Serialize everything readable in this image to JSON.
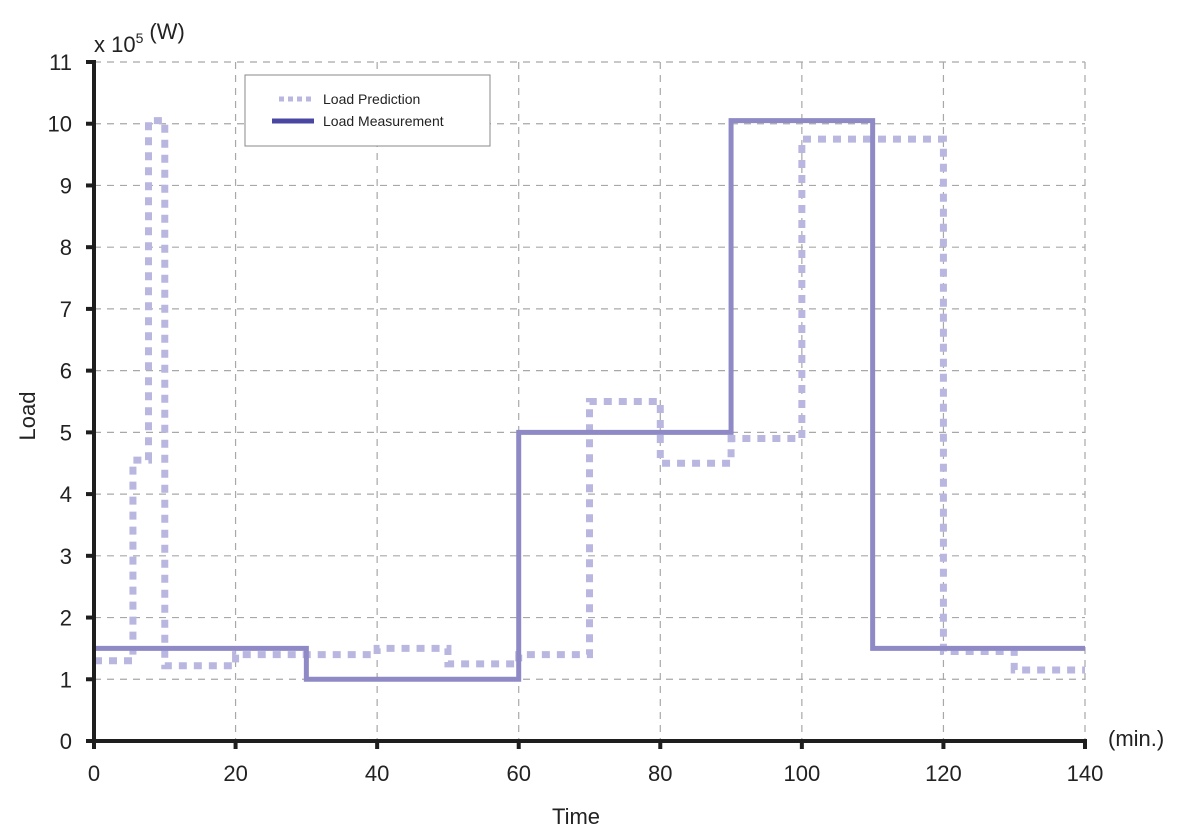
{
  "chart_data": {
    "type": "line",
    "style": "step",
    "title": "",
    "xlabel": "Time",
    "xunit": "(min.)",
    "ylabel": "Load",
    "yscale_label": "x 10",
    "yscale_exponent": "5",
    "yunit": "(W)",
    "xlim": [
      0,
      140
    ],
    "ylim": [
      0,
      11
    ],
    "xticks": [
      0,
      20,
      40,
      60,
      80,
      100,
      120,
      140
    ],
    "yticks": [
      0,
      1,
      2,
      3,
      4,
      5,
      6,
      7,
      8,
      9,
      10,
      11
    ],
    "grid": true,
    "legend_position": "top-left",
    "series": [
      {
        "name": "Load Prediction",
        "line_style": "dotted",
        "color": "#b9b6e0",
        "steps": [
          {
            "x0": 0,
            "x1": 5.5,
            "y": 1.3
          },
          {
            "x0": 5.5,
            "x1": 7.7,
            "y": 4.55
          },
          {
            "x0": 7.7,
            "x1": 10,
            "y": 10.05
          },
          {
            "x0": 10,
            "x1": 20,
            "y": 1.22
          },
          {
            "x0": 20,
            "x1": 40,
            "y": 1.4
          },
          {
            "x0": 40,
            "x1": 50,
            "y": 1.5
          },
          {
            "x0": 50,
            "x1": 60,
            "y": 1.25
          },
          {
            "x0": 60,
            "x1": 70,
            "y": 1.4
          },
          {
            "x0": 70,
            "x1": 80,
            "y": 5.5
          },
          {
            "x0": 80,
            "x1": 90,
            "y": 4.5
          },
          {
            "x0": 90,
            "x1": 100,
            "y": 4.9
          },
          {
            "x0": 100,
            "x1": 120,
            "y": 9.75
          },
          {
            "x0": 120,
            "x1": 130,
            "y": 1.45
          },
          {
            "x0": 130,
            "x1": 140,
            "y": 1.15
          }
        ]
      },
      {
        "name": "Load Measurement",
        "line_style": "solid",
        "color": "#8f8ac6",
        "legend_color": "#4a47a3",
        "steps": [
          {
            "x0": 0,
            "x1": 30,
            "y": 1.5
          },
          {
            "x0": 30,
            "x1": 60,
            "y": 1.0
          },
          {
            "x0": 60,
            "x1": 90,
            "y": 5.0
          },
          {
            "x0": 90,
            "x1": 110,
            "y": 10.05
          },
          {
            "x0": 110,
            "x1": 140,
            "y": 1.5
          }
        ]
      }
    ]
  }
}
